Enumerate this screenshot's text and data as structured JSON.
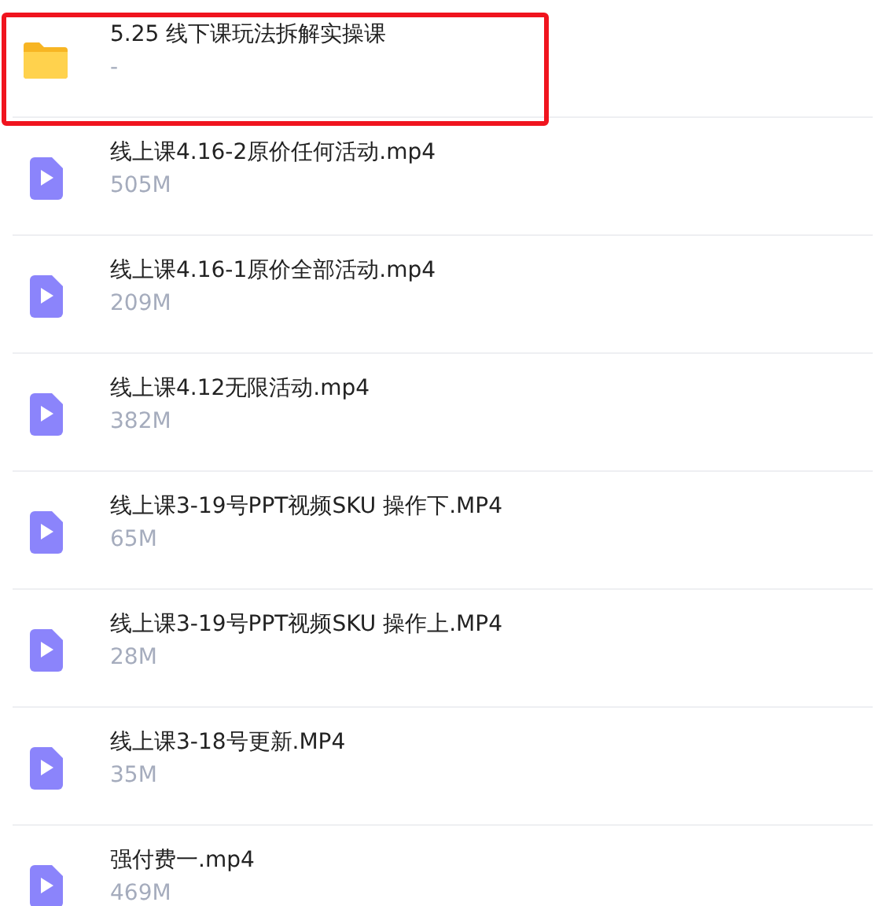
{
  "files": [
    {
      "kind": "folder",
      "name": "5.25 线下课玩法拆解实操课",
      "size": "-",
      "highlighted": true
    },
    {
      "kind": "video",
      "name": "线上课4.16-2原价任何活动.mp4",
      "size": "505M",
      "highlighted": false
    },
    {
      "kind": "video",
      "name": "线上课4.16-1原价全部活动.mp4",
      "size": "209M",
      "highlighted": false
    },
    {
      "kind": "video",
      "name": "线上课4.12无限活动.mp4",
      "size": "382M",
      "highlighted": false
    },
    {
      "kind": "video",
      "name": "线上课3-19号PPT视频SKU 操作下.MP4",
      "size": "65M",
      "highlighted": false
    },
    {
      "kind": "video",
      "name": "线上课3-19号PPT视频SKU 操作上.MP4",
      "size": "28M",
      "highlighted": false
    },
    {
      "kind": "video",
      "name": "线上课3-18号更新.MP4",
      "size": "35M",
      "highlighted": false
    },
    {
      "kind": "video",
      "name": "强付费一.mp4",
      "size": "469M",
      "highlighted": false
    }
  ]
}
